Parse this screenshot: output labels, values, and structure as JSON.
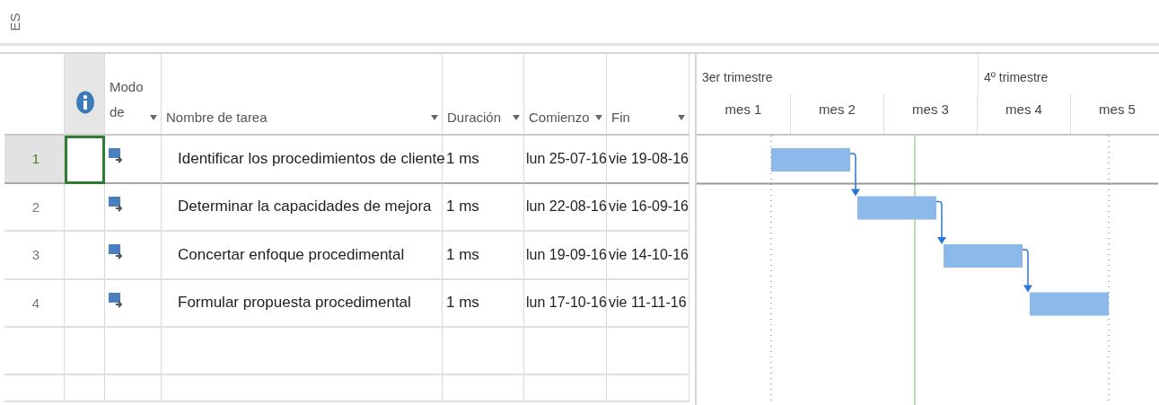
{
  "side_label": "ES",
  "columns": [
    {
      "kind": "rownum"
    },
    {
      "kind": "info"
    },
    {
      "kind": "mode",
      "label": "Modo de",
      "filter": true
    },
    {
      "kind": "name",
      "label": "Nombre de tarea",
      "filter": true
    },
    {
      "kind": "duration",
      "label": "Duración",
      "filter": true
    },
    {
      "kind": "start",
      "label": "Comienzo",
      "filter": true
    },
    {
      "kind": "end",
      "label": "Fin",
      "filter": true
    }
  ],
  "tasks": [
    {
      "id": "1",
      "name": "Identificar los procedimientos de cliente",
      "duration": "1 ms",
      "start": "lun 25-07-16",
      "end": "vie 19-08-16",
      "selected": true
    },
    {
      "id": "2",
      "name": "Determinar la capacidades de mejora",
      "duration": "1 ms",
      "start": "lun 22-08-16",
      "end": "vie 16-09-16",
      "selected": false
    },
    {
      "id": "3",
      "name": "Concertar enfoque procedimental",
      "duration": "1 ms",
      "start": "lun 19-09-16",
      "end": "vie 14-10-16",
      "selected": false
    },
    {
      "id": "4",
      "name": "Formular propuesta procedimental",
      "duration": "1 ms",
      "start": "lun 17-10-16",
      "end": "vie 11-11-16",
      "selected": false
    }
  ],
  "timescale": {
    "quarters": [
      "3er trimestre",
      "4º trimestre"
    ],
    "months": [
      "mes 1",
      "mes 2",
      "mes 3",
      "mes 4",
      "mes 5"
    ]
  }
}
